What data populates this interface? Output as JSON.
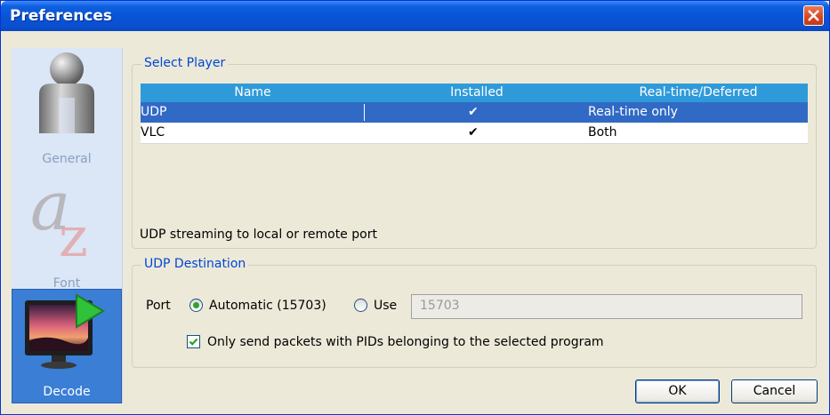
{
  "window": {
    "title": "Preferences"
  },
  "sidebar": {
    "items": [
      {
        "label": "General",
        "icon": "user-icon",
        "selected": false
      },
      {
        "label": "Font",
        "icon": "font-icon",
        "selected": false
      },
      {
        "label": "Decode",
        "icon": "monitor-play-icon",
        "selected": true
      }
    ]
  },
  "select_player": {
    "legend": "Select Player",
    "columns": [
      "Name",
      "Installed",
      "Real-time/Deferred"
    ],
    "rows": [
      {
        "name": "UDP",
        "installed": "✔",
        "mode": "Real-time only",
        "selected": true
      },
      {
        "name": "VLC",
        "installed": "✔",
        "mode": "Both",
        "selected": false
      }
    ],
    "description": "UDP streaming to local or remote port"
  },
  "udp_destination": {
    "legend": "UDP Destination",
    "port_label": "Port",
    "automatic_label": "Automatic (15703)",
    "use_label": "Use",
    "port_value": "15703",
    "selected_option": "automatic",
    "pid_filter_label": "Only send packets with PIDs belonging to the selected program",
    "pid_filter_checked": true
  },
  "buttons": {
    "ok": "OK",
    "cancel": "Cancel"
  },
  "colors": {
    "title_bar": "#0853d6",
    "selection": "#316ac5",
    "header": "#2f9ad9",
    "legend": "#0046d5",
    "sidebar_selected": "#3a7ed6"
  }
}
